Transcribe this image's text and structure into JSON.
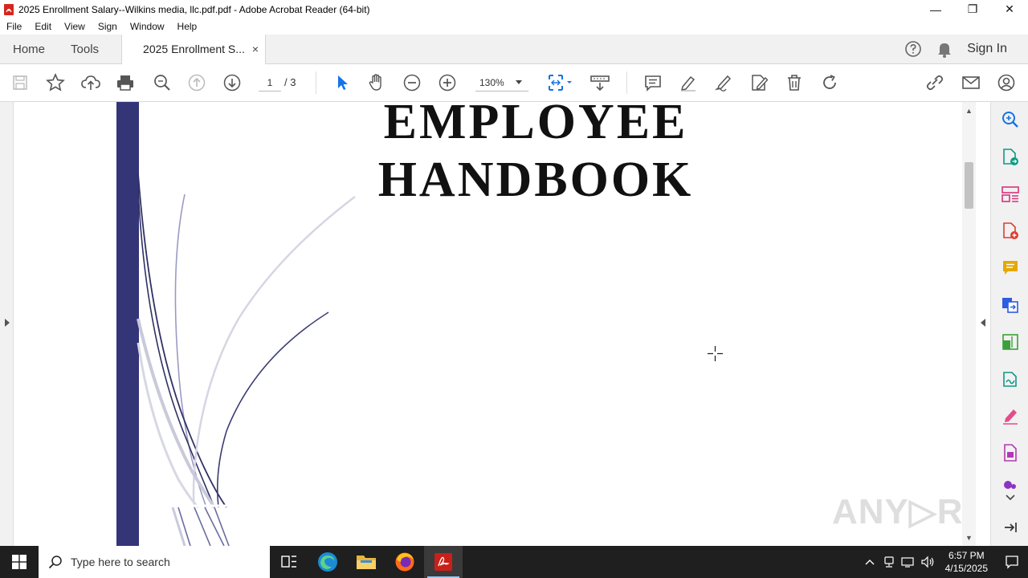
{
  "window": {
    "title": "2025 Enrollment  Salary--Wilkins media, llc.pdf.pdf - Adobe Acrobat Reader (64-bit)",
    "minimize": "—",
    "maximize": "❐",
    "close": "✕"
  },
  "menu": [
    "File",
    "Edit",
    "View",
    "Sign",
    "Window",
    "Help"
  ],
  "tabs": {
    "home": "Home",
    "tools": "Tools",
    "document": "2025 Enrollment  S...",
    "close": "×",
    "sign_in": "Sign In"
  },
  "toolbar": {
    "page_current": "1",
    "page_total": "/ 3",
    "zoom": "130%"
  },
  "document": {
    "heading_line1": "EMPLOYEE",
    "heading_line2": "HANDBOOK"
  },
  "watermark": "ANY▷RUN",
  "taskbar": {
    "search_placeholder": "Type here to search",
    "time": "6:57 PM",
    "date": "4/15/2025"
  },
  "colors": {
    "acrobat_red": "#d7261e",
    "accent_blue": "#1473e6",
    "stripe_navy": "#333577",
    "taskbar": "#1f1f1f"
  }
}
